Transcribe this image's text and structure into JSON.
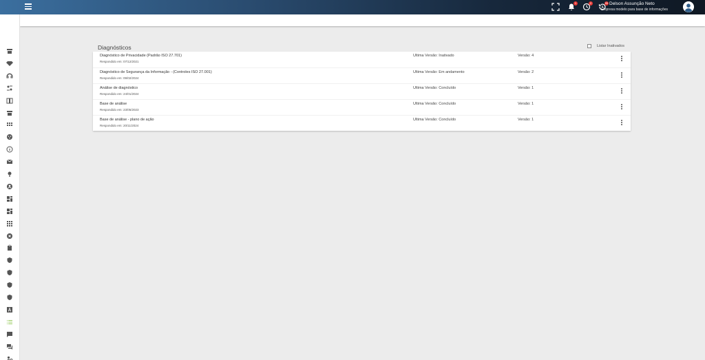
{
  "topbar": {
    "notifications_badge": "1",
    "tasks_badge": "2",
    "updates_badge": "99",
    "user_name": "Delson Assunção Neto",
    "user_company": "Empresa modelo para base de informações"
  },
  "sidebar": {
    "items": [
      {
        "icon": "store-icon"
      },
      {
        "icon": "diamond-icon"
      },
      {
        "icon": "headset-icon"
      },
      {
        "icon": "people-sync-icon"
      },
      {
        "icon": "book-icon"
      },
      {
        "icon": "store-icon"
      },
      {
        "icon": "grid-icon"
      },
      {
        "icon": "palette-icon"
      },
      {
        "icon": "info-icon"
      },
      {
        "icon": "mail-icon"
      },
      {
        "icon": "lightbulb-icon"
      },
      {
        "icon": "account-circle-icon"
      },
      {
        "icon": "dashboard-icon"
      },
      {
        "icon": "dashboard-icon"
      },
      {
        "icon": "apps-icon"
      },
      {
        "icon": "cancel-icon"
      },
      {
        "icon": "clipboard-icon"
      },
      {
        "icon": "shield-icon"
      },
      {
        "icon": "shield-icon"
      },
      {
        "icon": "shield-icon"
      },
      {
        "icon": "shield-icon"
      },
      {
        "icon": "font-icon"
      },
      {
        "icon": "list-icon",
        "active": true
      },
      {
        "icon": "chat-icon"
      },
      {
        "icon": "forum-icon"
      },
      {
        "icon": "settings-people-icon"
      }
    ],
    "active_color": "#9ccc65"
  },
  "page": {
    "title": "Diagnósticos",
    "filter_label": "Listar Inativados"
  },
  "diagnostics": [
    {
      "name": "Diagnóstico de Privacidade (Padrão ISO 27.701)",
      "answered": "Respondido em: 07/12/2021",
      "status": "Ultima Versão: Inativado",
      "version": "Versão: 4"
    },
    {
      "name": "Diagnóstico de Segurança da Informação - (Controles ISO 27.001)",
      "answered": "Respondido em: 09/02/2024",
      "status": "Ultima Versão: Em andamento",
      "version": "Versão: 2"
    },
    {
      "name": "Análise de diagnóstico",
      "answered": "Respondido em: 24/01/2024",
      "status": "Ultima Versão: Concluído",
      "version": "Versão: 1"
    },
    {
      "name": "Base de análise",
      "answered": "Respondido em: 23/05/2023",
      "status": "Ultima Versão: Concluído",
      "version": "Versão: 1"
    },
    {
      "name": "Base de análise - plano de ação",
      "answered": "Respondido em: 20/11/2024",
      "status": "Ultima Versão: Concluído",
      "version": "Versão: 1"
    }
  ]
}
